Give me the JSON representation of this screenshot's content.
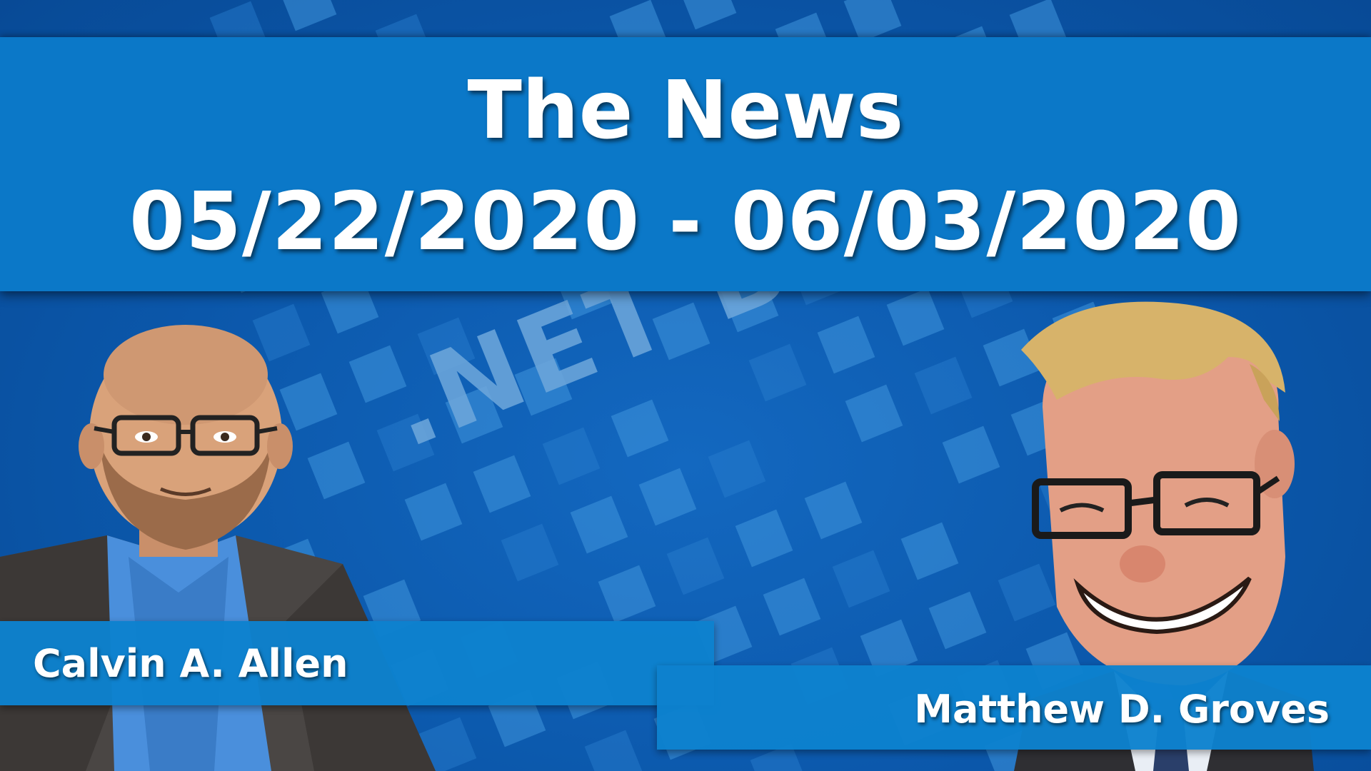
{
  "title": {
    "line1": "The News",
    "line2": "05/22/2020 - 06/03/2020"
  },
  "watermark": ".NET BYTES",
  "hosts": {
    "left": {
      "name": "Calvin A. Allen"
    },
    "right": {
      "name": "Matthew D. Groves"
    }
  },
  "colors": {
    "background": "#0b57aa",
    "band": "#0b78c8",
    "square": "#3f95dd",
    "text": "#ffffff"
  }
}
